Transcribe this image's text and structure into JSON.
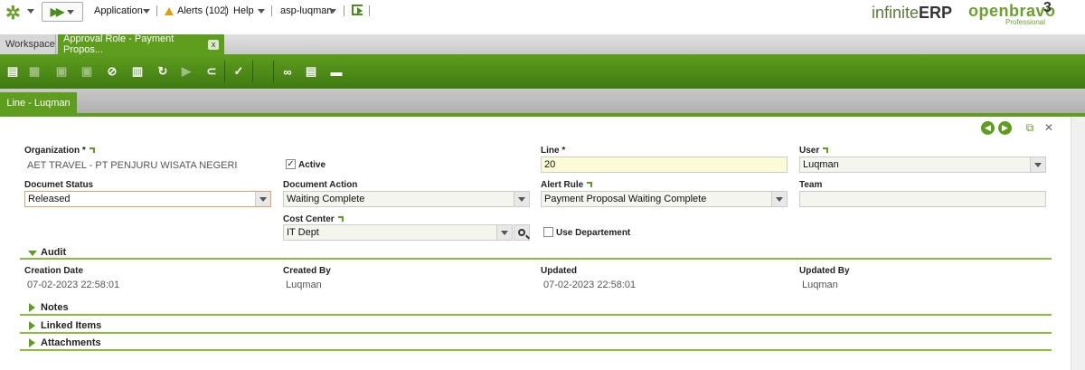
{
  "topbar": {
    "application": "Application",
    "alerts": "Alerts (102)",
    "help": "Help",
    "user": "asp-luqman",
    "logo_infinite": "infinite",
    "logo_erp": "ERP",
    "logo_openbravo": "openbravo",
    "logo_openbravo_sub": "Professional",
    "logo_version": "3"
  },
  "tabs": {
    "workspace": "Workspace",
    "active": "Approval Role - Payment Propos...",
    "close": "x"
  },
  "subtab": {
    "label": "Line - Luqman"
  },
  "form": {
    "organization": {
      "label": "Organization *",
      "value": "AET TRAVEL - PT PENJURU WISATA NEGERI"
    },
    "active": {
      "label": "Active",
      "checked": true
    },
    "line": {
      "label": "Line *",
      "value": "20"
    },
    "user": {
      "label": "User",
      "value": "Luqman"
    },
    "document_status": {
      "label": "Documet Status",
      "value": "Released"
    },
    "document_action": {
      "label": "Document Action",
      "value": "Waiting Complete"
    },
    "alert_rule": {
      "label": "Alert Rule",
      "value": "Payment Proposal Waiting Complete"
    },
    "team": {
      "label": "Team",
      "value": ""
    },
    "cost_center": {
      "label": "Cost Center",
      "value": "IT Dept"
    },
    "use_departement": {
      "label": "Use Departement",
      "checked": false
    }
  },
  "audit": {
    "title": "Audit",
    "creation_date": {
      "label": "Creation Date",
      "value": "07-02-2023 22:58:01"
    },
    "created_by": {
      "label": "Created By",
      "value": "Luqman"
    },
    "updated": {
      "label": "Updated",
      "value": "07-02-2023 22:58:01"
    },
    "updated_by": {
      "label": "Updated By",
      "value": "Luqman"
    }
  },
  "sections": {
    "notes": "Notes",
    "linked_items": "Linked Items",
    "attachments": "Attachments"
  },
  "colors": {
    "brand_green": "#5e9d1e",
    "required_bg": "#fbfbd6"
  }
}
